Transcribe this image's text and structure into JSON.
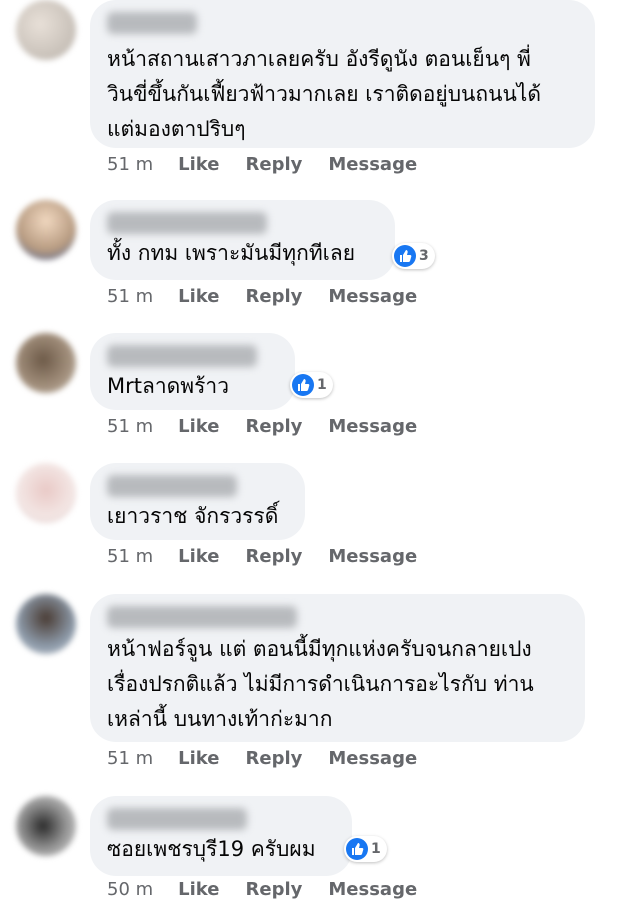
{
  "comments": [
    {
      "text": "หน้าสถานเสาวภาเลยครับ อังรีดูนัง ตอนเย็นๆ พี่\nวินขี่ขึ้นกันเฟี้ยวฟ้าวมากเลย เราติดอยู่บนถนนได้\nแต่มองตาปริบๆ",
      "time": "51 m",
      "like": "Like",
      "reply": "Reply",
      "message": "Message",
      "reactions": ""
    },
    {
      "text": "ทั้ง กทม เพราะมันมีทุกทีเลย",
      "time": "51 m",
      "like": "Like",
      "reply": "Reply",
      "message": "Message",
      "reactions": "3"
    },
    {
      "text": "Mrtลาดพร้าว",
      "time": "51 m",
      "like": "Like",
      "reply": "Reply",
      "message": "Message",
      "reactions": "1"
    },
    {
      "text": "เยาวราช จักรวรรดิ์",
      "time": "51 m",
      "like": "Like",
      "reply": "Reply",
      "message": "Message",
      "reactions": ""
    },
    {
      "text": "หน้าฟอร์จูน แต่ ตอนนี้มีทุกแห่งครับจนกลายเปง\nเรื่องปรกติแล้ว ไม่มีการดำเนินการอะไรกับ ท่าน\nเหล่านี้ บนทางเท้าก่ะมาก",
      "time": "51 m",
      "like": "Like",
      "reply": "Reply",
      "message": "Message",
      "reactions": ""
    },
    {
      "text": "ซอยเพชรบุรี19 ครับผม",
      "time": "50 m",
      "like": "Like",
      "reply": "Reply",
      "message": "Message",
      "reactions": "1"
    }
  ],
  "colors": {
    "bubble": "#f0f2f5",
    "text": "#050505",
    "meta": "#65676b",
    "like_blue": "#1877f2"
  }
}
